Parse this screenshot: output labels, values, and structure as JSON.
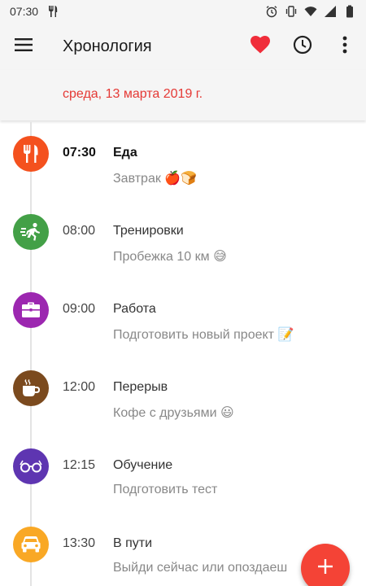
{
  "status_bar": {
    "time": "07:30",
    "left_icon": "fork-knife-icon",
    "right_icons": [
      "alarm-icon",
      "vibrate-icon",
      "wifi-icon",
      "signal-icon",
      "battery-icon"
    ]
  },
  "app_bar": {
    "title": "Хронология",
    "menu_icon": "hamburger-menu-icon",
    "favorite_icon": "heart-icon",
    "history_icon": "clock-icon",
    "more_icon": "more-vert-icon",
    "favorite_color": "#f02d3a"
  },
  "date_header": {
    "label": "среда, 13 марта 2019 г.",
    "color": "#e53935"
  },
  "entries": [
    {
      "time": "07:30",
      "title": "Еда",
      "note": "Завтрак 🍎🍞",
      "icon": "fork-knife-icon",
      "color": "#f4511e"
    },
    {
      "time": "08:00",
      "title": "Тренировки",
      "note": "Пробежка 10 км 😅",
      "icon": "running-icon",
      "color": "#43a047"
    },
    {
      "time": "09:00",
      "title": "Работа",
      "note": "Подготовить новый проект 📝",
      "icon": "briefcase-icon",
      "color": "#9c27b0"
    },
    {
      "time": "12:00",
      "title": "Перерыв",
      "note": "Кофе с друзьями 😃",
      "icon": "coffee-cup-icon",
      "color": "#7b4a1e"
    },
    {
      "time": "12:15",
      "title": "Обучение",
      "note": "Подготовить тест",
      "icon": "glasses-icon",
      "color": "#5e35b1"
    },
    {
      "time": "13:30",
      "title": "В пути",
      "note": "Выйди сейчас или опоздаеш",
      "icon": "car-icon",
      "color": "#f9a825"
    }
  ],
  "fab": {
    "icon": "plus-icon",
    "color": "#f44336"
  }
}
